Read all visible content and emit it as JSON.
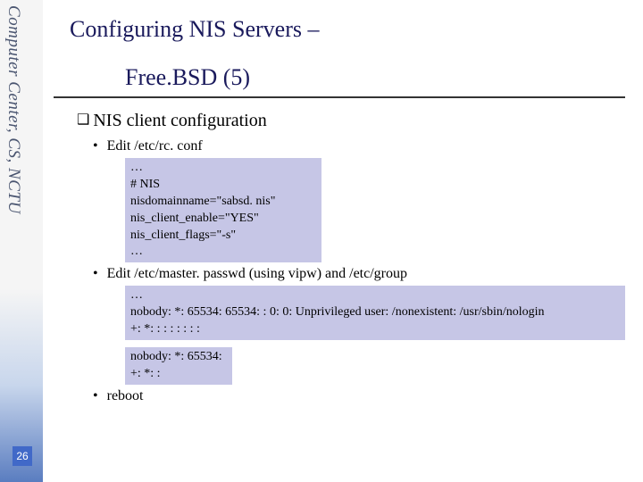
{
  "sidebar": {
    "label": "Computer Center, CS, NCTU"
  },
  "page_number": "26",
  "title": {
    "line1": "Configuring NIS Servers –",
    "line2": "Free.BSD (5)"
  },
  "section_heading": "NIS client configuration",
  "bullets": {
    "b1": "Edit /etc/rc. conf",
    "b2": "Edit /etc/master. passwd (using vipw) and /etc/group",
    "b3": "reboot"
  },
  "code": {
    "rcconf": "…\n# NIS\nnisdomainname=\"sabsd. nis\"\nnis_client_enable=\"YES\"\nnis_client_flags=\"-s\"\n…",
    "passwd": "…\nnobody: *: 65534: 65534: : 0: 0: Unprivileged user: /nonexistent: /usr/sbin/nologin\n+: *: : : : : : : :",
    "group": "nobody: *: 65534:\n+: *: :"
  }
}
